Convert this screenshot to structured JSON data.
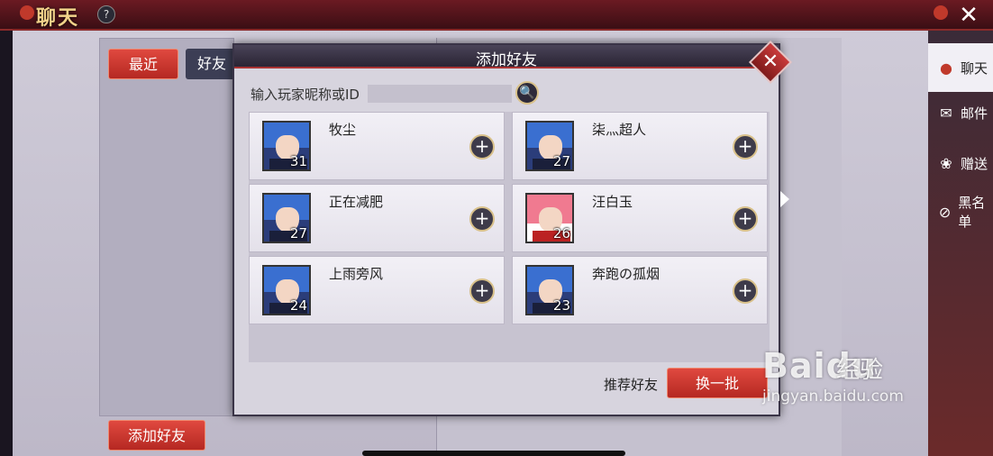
{
  "topbar": {
    "title": "聊天",
    "help_icon": "?",
    "close_icon": "✕"
  },
  "tabs": {
    "recent": "最近",
    "friends": "好友"
  },
  "left_panel": {
    "add_friend_button": "添加好友"
  },
  "sidebar": {
    "items": [
      {
        "label": "聊天",
        "icon": "chat-bubble-icon",
        "glyph": "●",
        "active": true
      },
      {
        "label": "邮件",
        "icon": "mail-icon",
        "glyph": "✉",
        "active": false
      },
      {
        "label": "赠送",
        "icon": "gift-icon",
        "glyph": "❀",
        "active": false
      },
      {
        "label": "黑名单",
        "icon": "blacklist-icon",
        "glyph": "⊘",
        "active": false
      }
    ]
  },
  "modal": {
    "title": "添加好友",
    "close_icon": "✕",
    "search_label": "输入玩家昵称或ID",
    "search_placeholder": "",
    "search_icon": "🔍",
    "players": [
      {
        "name": "牧尘",
        "level": "31",
        "avatar": "blue-hair"
      },
      {
        "name": "柒灬超人",
        "level": "27",
        "avatar": "blue-hair"
      },
      {
        "name": "正在减肥",
        "level": "27",
        "avatar": "blue-hair"
      },
      {
        "name": "汪白玉",
        "level": "26",
        "avatar": "pink-hair"
      },
      {
        "name": "上雨旁风",
        "level": "24",
        "avatar": "blue-hair"
      },
      {
        "name": "奔跑の孤烟",
        "level": "23",
        "avatar": "blue-hair"
      }
    ],
    "add_icon": "+",
    "recommend_label": "推荐好友",
    "refresh_button": "换一批"
  },
  "watermark": {
    "logo": "Baidu",
    "subtitle": "经验",
    "url": "jingyan.baidu.com"
  }
}
